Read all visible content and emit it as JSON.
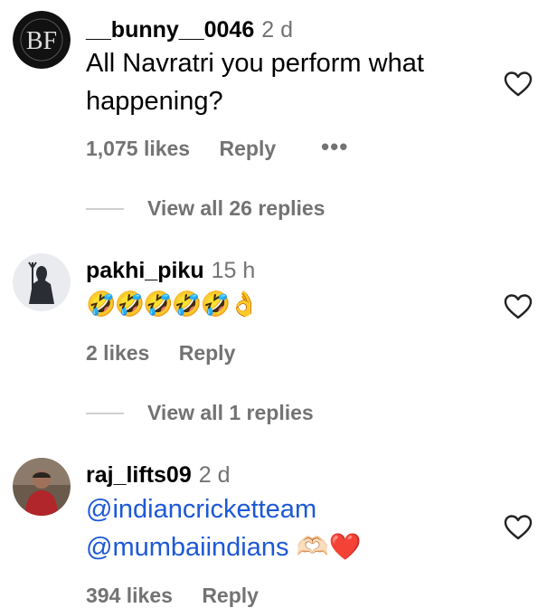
{
  "comments": [
    {
      "username": "__bunny__0046",
      "time": "2 d",
      "text_line1": "All Navratri you perform what",
      "text_line2": "happening?",
      "likes": "1,075 likes",
      "reply": "Reply",
      "more": "•••",
      "view_replies": "View all 26 replies",
      "avatar_monogram": "BF"
    },
    {
      "username": "pakhi_piku",
      "time": "15 h",
      "emojis": "🤣🤣🤣🤣🤣👌",
      "likes": "2 likes",
      "reply": "Reply",
      "view_replies": "View all 1 replies"
    },
    {
      "username": "raj_lifts09",
      "time": "2 d",
      "mention1": "@indiancricketteam",
      "mention2": "@mumbaiindians",
      "emoji_hands": "🫶🏻",
      "emoji_heart": "❤️",
      "likes": "394 likes",
      "reply": "Reply"
    }
  ],
  "colors": {
    "secondary_text": "#737373",
    "mention": "#1d58d6",
    "divider": "#d0d0d0"
  }
}
